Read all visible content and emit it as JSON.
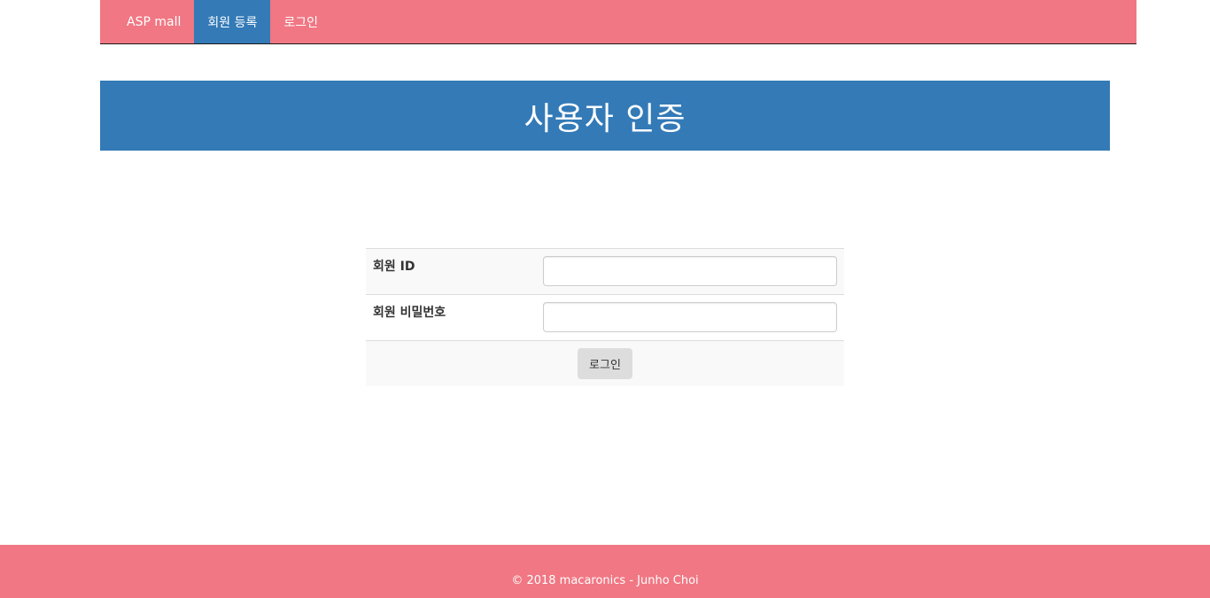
{
  "navbar": {
    "brand": "ASP mall",
    "items": [
      {
        "label": "회원 등록",
        "active": true
      },
      {
        "label": "로그인",
        "active": false
      }
    ],
    "color": "#f07783",
    "active_color": "#337ab7"
  },
  "jumbotron": {
    "title": "사용자 인증",
    "color": "#337ab7"
  },
  "login_form": {
    "id_label": "회원 ID",
    "id_value": "",
    "password_label": "회원 비밀번호",
    "password_value": "",
    "submit_label": "로그인"
  },
  "footer": {
    "text": "© 2018 macaronics - Junho Choi"
  }
}
